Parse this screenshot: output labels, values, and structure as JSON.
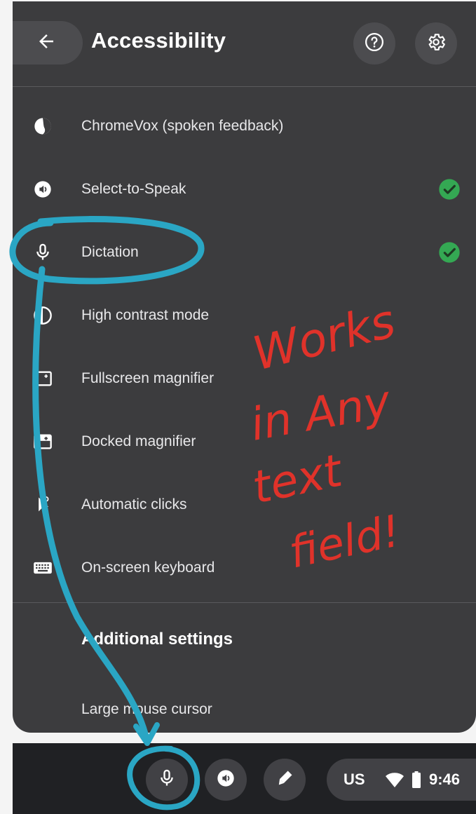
{
  "header": {
    "title": "Accessibility",
    "back_icon": "arrow-left-icon",
    "help_icon": "help-circle-icon",
    "settings_icon": "gear-icon"
  },
  "items": [
    {
      "label": "ChromeVox (spoken feedback)",
      "icon": "chromevox-icon",
      "checked": false
    },
    {
      "label": "Select-to-Speak",
      "icon": "select-to-speak-icon",
      "checked": true
    },
    {
      "label": "Dictation",
      "icon": "microphone-icon",
      "checked": true
    },
    {
      "label": "High contrast mode",
      "icon": "contrast-icon",
      "checked": false
    },
    {
      "label": "Fullscreen magnifier",
      "icon": "fullscreen-magnifier-icon",
      "checked": false
    },
    {
      "label": "Docked magnifier",
      "icon": "docked-magnifier-icon",
      "checked": false
    },
    {
      "label": "Automatic clicks",
      "icon": "autoclick-icon",
      "checked": false
    },
    {
      "label": "On-screen keyboard",
      "icon": "keyboard-icon",
      "checked": false
    }
  ],
  "additional": {
    "title": "Additional settings",
    "large_cursor": "Large mouse cursor"
  },
  "shelf": {
    "locale": "US",
    "time": "9:46"
  },
  "annotation": {
    "handwritten_text": [
      "Works",
      "in Any",
      "text",
      "field!"
    ]
  },
  "colors": {
    "panel_bg": "#3c3c3e",
    "check_green": "#34a853",
    "annotation_blue": "#2aa6c4",
    "annotation_red": "#e0322a"
  }
}
